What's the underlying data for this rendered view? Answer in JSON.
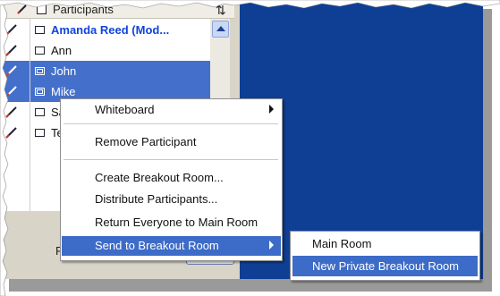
{
  "header": {
    "column_label": "Participants"
  },
  "participants": [
    {
      "name": "Amanda Reed (Mod...",
      "moderator": true,
      "selected": false
    },
    {
      "name": "Ann",
      "moderator": false,
      "selected": false
    },
    {
      "name": "John",
      "moderator": false,
      "selected": true
    },
    {
      "name": "Mike",
      "moderator": false,
      "selected": true
    },
    {
      "name": "Sa",
      "moderator": false,
      "selected": false
    },
    {
      "name": "Te",
      "moderator": false,
      "selected": false
    }
  ],
  "bottom": {
    "label": "Pa"
  },
  "context_menu": {
    "items": [
      {
        "label": "Whiteboard",
        "submenu": true
      },
      {
        "label": "Remove Participant"
      },
      {
        "label": "Create Breakout Room..."
      },
      {
        "label": "Distribute Participants..."
      },
      {
        "label": "Return Everyone to Main Room"
      },
      {
        "label": "Send to Breakout Room",
        "submenu": true,
        "highlighted": true
      }
    ]
  },
  "submenu": {
    "items": [
      {
        "label": "Main Room"
      },
      {
        "label": "New Private Breakout Room",
        "highlighted": true
      }
    ]
  },
  "colors": {
    "selection": "#3d6cc8",
    "background": "#0f3f95",
    "moderator_text": "#1144dd"
  },
  "icons": [
    "pencil-icon",
    "checkbox-icon",
    "sort-icon",
    "scroll-up-arrow-icon",
    "submenu-arrow-icon"
  ]
}
